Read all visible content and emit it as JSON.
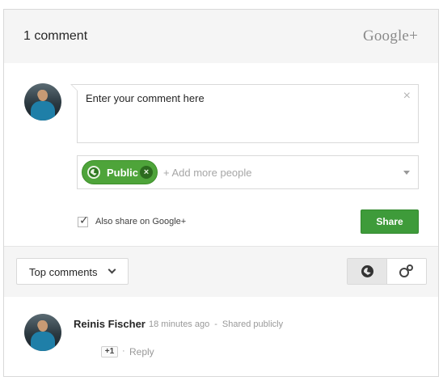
{
  "header": {
    "comment_count": "1 comment",
    "brand": "Google+"
  },
  "compose": {
    "input_placeholder": "Enter your comment here",
    "clear_symbol": "×",
    "audience_chip": "Public",
    "chip_remove_symbol": "×",
    "add_people_placeholder": "+ Add more people",
    "also_share_label": "Also share on Google+",
    "also_share_checked": true,
    "checkmark_symbol": "✓",
    "share_button": "Share"
  },
  "sortbar": {
    "sort_label": "Top comments",
    "views": [
      "public-icon",
      "circles-icon"
    ],
    "active_view": "public"
  },
  "comments": [
    {
      "author": "Reinis Fischer",
      "time": "18 minutes ago",
      "separator": "-",
      "visibility": "Shared publicly",
      "plus_one": "+1",
      "reply_separator": "·",
      "reply": "Reply"
    }
  ],
  "colors": {
    "accent_green": "#4ea43a",
    "share_button": "#3e9b3a",
    "header_bg": "#f5f5f5",
    "border": "#d9d9d9"
  }
}
